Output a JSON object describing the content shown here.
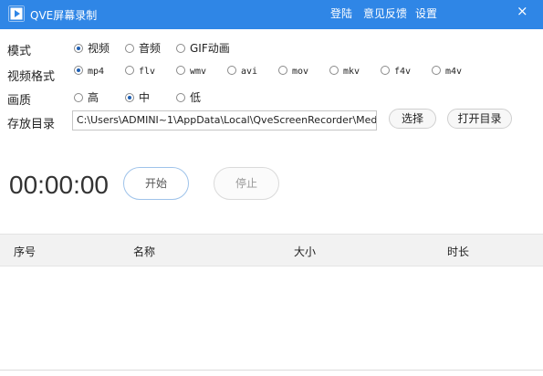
{
  "titlebar": {
    "title": "QVE屏幕录制",
    "links": [
      "登陆",
      "意见反馈",
      "设置"
    ],
    "close": "×"
  },
  "mode": {
    "label": "模式",
    "options": [
      {
        "label": "视频",
        "selected": true
      },
      {
        "label": "音频",
        "selected": false
      },
      {
        "label": "GIF动画",
        "selected": false
      }
    ]
  },
  "format": {
    "label": "视频格式",
    "options": [
      {
        "label": "mp4",
        "selected": true
      },
      {
        "label": "flv",
        "selected": false
      },
      {
        "label": "wmv",
        "selected": false
      },
      {
        "label": "avi",
        "selected": false
      },
      {
        "label": "mov",
        "selected": false
      },
      {
        "label": "mkv",
        "selected": false
      },
      {
        "label": "f4v",
        "selected": false
      },
      {
        "label": "m4v",
        "selected": false
      }
    ]
  },
  "quality": {
    "label": "画质",
    "options": [
      {
        "label": "高",
        "selected": false
      },
      {
        "label": "中",
        "selected": true
      },
      {
        "label": "低",
        "selected": false
      }
    ]
  },
  "storage": {
    "label": "存放目录",
    "path": "C:\\Users\\ADMINI~1\\AppData\\Local\\QveScreenRecorder\\Med",
    "choose_label": "选择",
    "open_label": "打开目录"
  },
  "recorder": {
    "timer": "00:00:00",
    "start_label": "开始",
    "stop_label": "停止"
  },
  "table": {
    "columns": [
      "序号",
      "名称",
      "大小",
      "时长"
    ]
  },
  "colors": {
    "titlebar": "#2f86e6",
    "accent": "#1f5fb3"
  }
}
